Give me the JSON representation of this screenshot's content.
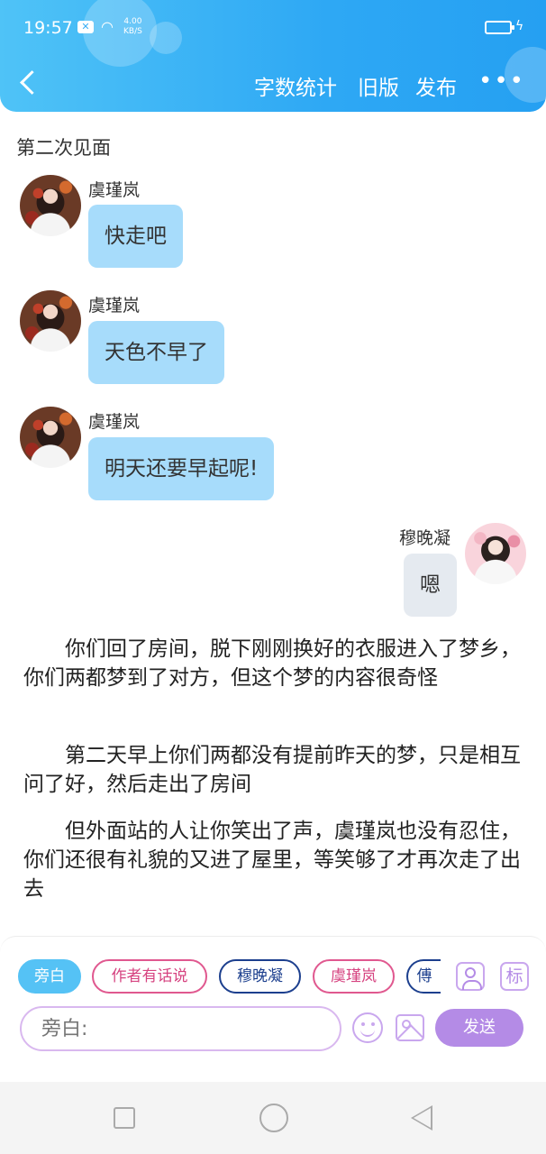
{
  "status_bar": {
    "time": "19:57",
    "speed_value": "4.00",
    "speed_unit": "KB/S"
  },
  "header": {
    "buttons": [
      "字数统计",
      "旧版",
      "发布"
    ],
    "more": "•••"
  },
  "chapter_title": "第二次见面",
  "messages": [
    {
      "sender": "虞瑾岚",
      "text": "快走吧",
      "side": "left"
    },
    {
      "sender": "虞瑾岚",
      "text": "天色不早了",
      "side": "left"
    },
    {
      "sender": "虞瑾岚",
      "text": "明天还要早起呢!",
      "side": "left"
    },
    {
      "sender": "穆晚凝",
      "text": "嗯",
      "side": "right"
    }
  ],
  "narration": [
    "你们回了房间，脱下刚刚换好的衣服进入了梦乡，你们两都梦到了对方，但这个梦的内容很奇怪",
    "第二天早上你们两都没有提前昨天的梦，只是相互问了好，然后走出了房间",
    "但外面站的人让你笑出了声，虞瑾岚也没有忍住，你们还很有礼貌的又进了屋里，等笑够了才再次走了出去"
  ],
  "role_chips": [
    "旁白",
    "作者有话说",
    "穆晚凝",
    "虞瑾岚",
    "傅"
  ],
  "tool_icons": {
    "role_icon": "person-icon",
    "tag_label": "标"
  },
  "input": {
    "placeholder": "旁白:"
  },
  "send_label": "发送",
  "colors": {
    "header": "#2ea8f4",
    "left_bubble": "#a7dcfb",
    "right_bubble": "#e5eaf0",
    "accent": "#b48be6",
    "chip_active": "#55c2f5",
    "chip_pink": "#d64380",
    "chip_blue": "#1c3f8e"
  }
}
